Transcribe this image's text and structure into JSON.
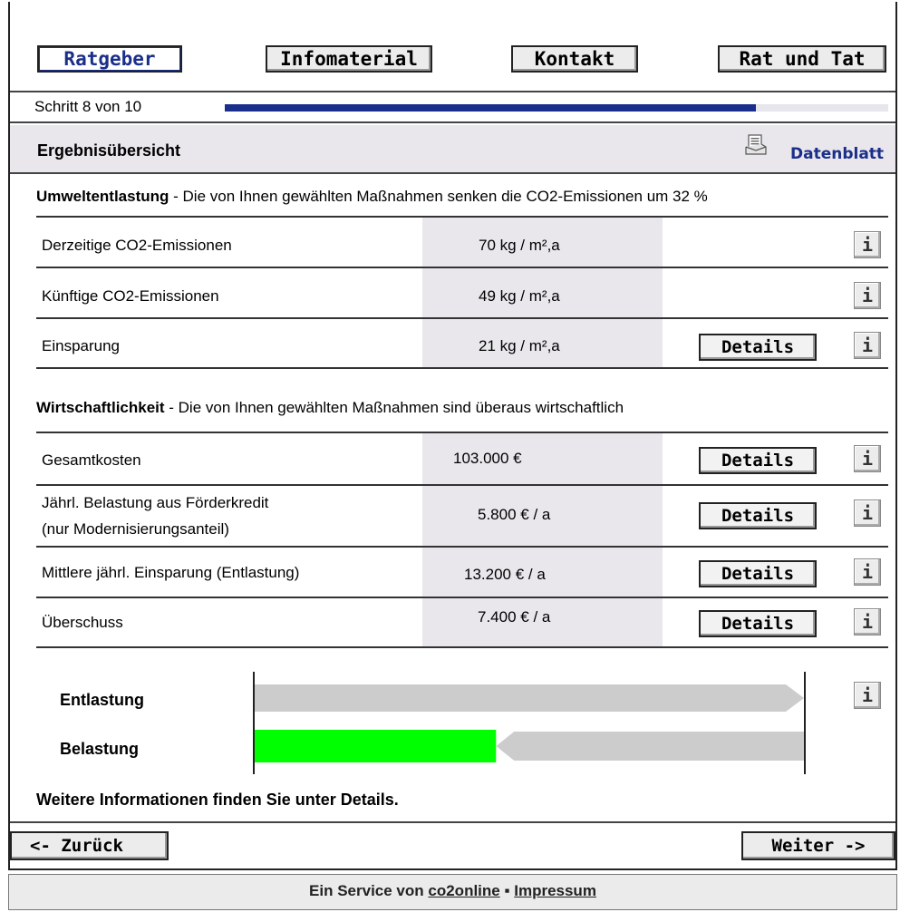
{
  "nav": {
    "ratgeber": "Ratgeber",
    "infomaterial": "Infomaterial",
    "kontakt": "Kontakt",
    "rat_und_tat": "Rat und Tat"
  },
  "step": {
    "text": "Schritt 8 von 10",
    "progress_fraction": 0.8
  },
  "header": {
    "title": "Ergebnisübersicht",
    "datenblatt": "Datenblatt",
    "datenblatt_icon": "document-icon"
  },
  "umwelt": {
    "title": "Umweltentlastung",
    "desc": " - Die von Ihnen gewählten Maßnahmen senken die CO2-Emissionen um 32 %",
    "rows": [
      {
        "label": "Derzeitige CO2-Emissionen",
        "value": "70 kg / m²,a"
      },
      {
        "label": "Künftige CO2-Emissionen",
        "value": "49 kg / m²,a"
      },
      {
        "label": "Einsparung",
        "value": "21 kg / m²,a",
        "button": "Details"
      }
    ]
  },
  "wirtschaft": {
    "title": "Wirtschaftlichkeit",
    "desc": " - Die von Ihnen gewählten Maßnahmen sind überaus wirtschaftlich",
    "rows": [
      {
        "label": "Gesamtkosten",
        "value": "103.000 €",
        "button": "Details"
      },
      {
        "label": "Jährl. Belastung aus Förderkredit",
        "label2": "(nur Modernisierungsanteil)",
        "value": "5.800 € / a",
        "button": "Details"
      },
      {
        "label": "Mittlere jährl. Einsparung (Entlastung)",
        "value": "13.200 € / a",
        "button": "Details"
      },
      {
        "label": "Überschuss",
        "value": "7.400 € / a",
        "button": "Details"
      }
    ]
  },
  "info_button": "i",
  "bars": {
    "entlastung": {
      "label": "Entlastung",
      "value": 13200,
      "color": "#cccccc"
    },
    "belastung": {
      "label": "Belastung",
      "value": 5800,
      "color": "#00ff00",
      "surplus_color": "#cccccc"
    }
  },
  "note": "Weitere Informationen finden Sie unter Details.",
  "back_button": "<- Zurück",
  "next_button": "Weiter ->",
  "footer": {
    "prefix": "Ein Service von ",
    "link1": "co2online",
    "sep": " ▪ ",
    "link2": "Impressum"
  }
}
